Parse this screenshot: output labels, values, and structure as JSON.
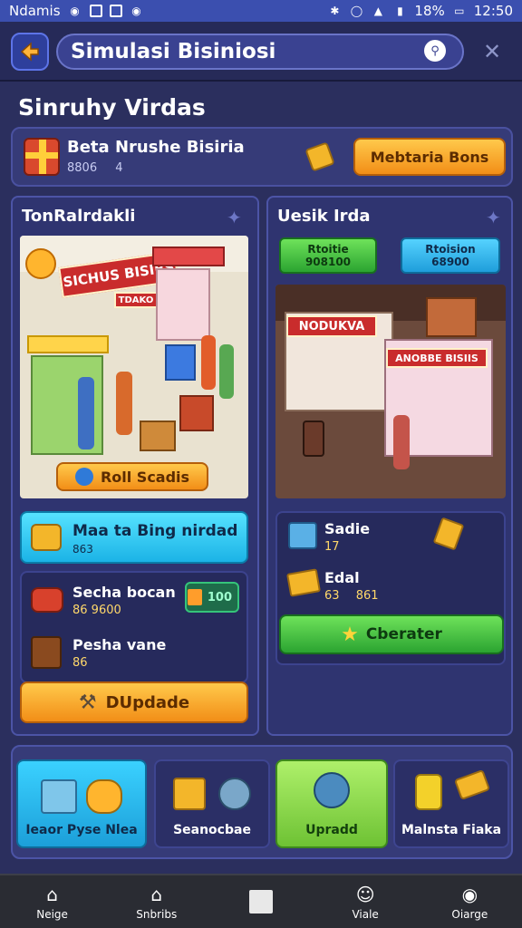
{
  "status_bar": {
    "carrier": "Ndamis",
    "battery": "18%",
    "time": "12:50"
  },
  "header": {
    "title": "Simulasi Bisiniosi"
  },
  "section_title": "Sinruhy Virdas",
  "business": {
    "name": "Beta Nrushe Bisiria",
    "value": "8806",
    "value_suffix": "4",
    "button_label": "Mebtaria Bons"
  },
  "left_panel": {
    "title": "TonRalrdakli",
    "shop_sign": "SICHUS BISIBS",
    "shop_small_sign": "TDAKO",
    "scene_button": "Roll Scadis",
    "card": {
      "title": "Maa ta Bing nirdad",
      "sub": "863"
    },
    "stats": [
      {
        "title": "Secha bocan",
        "value": "86 9600"
      },
      {
        "title": "Pesha vane",
        "value": "86"
      }
    ],
    "badge": "100",
    "upgrade_label": "DUpdade"
  },
  "right_panel": {
    "title": "Uesik Irda",
    "chip_green": {
      "label": "Rtoitie",
      "value": "908100"
    },
    "chip_cyan": {
      "label": "Rtoision",
      "value": "68900"
    },
    "scene_sign": "NODUKVA",
    "scene_sign_2": "ANOBBE BISIIS",
    "stats": [
      {
        "title": "Sadie",
        "value": "17"
      },
      {
        "title": "Edal",
        "value_a": "63",
        "value_b": "861"
      }
    ],
    "operate_label": "Cberater"
  },
  "bottom_tiles": [
    {
      "label": "Ieaor Pyse Nlea"
    },
    {
      "label": "Seanocbae"
    },
    {
      "label": "Upradd"
    },
    {
      "label": "Malnsta Fiaka"
    }
  ],
  "nav": [
    {
      "label": "Neige"
    },
    {
      "label": "Snbribs"
    },
    {
      "label": ""
    },
    {
      "label": "Viale"
    },
    {
      "label": "Oiarge"
    }
  ],
  "colors": {
    "background": "#2b2f5e",
    "status_bar": "#3b4faf",
    "orange_button": "#f28e17",
    "green_button": "#2ba431",
    "cyan_card": "#1bb3e6"
  }
}
